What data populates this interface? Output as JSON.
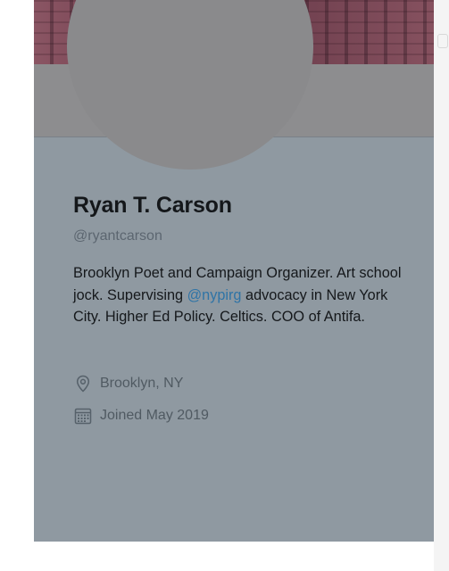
{
  "profile": {
    "name": "Ryan T. Carson",
    "handle": "@ryantcarson",
    "bio": {
      "part1": "Brooklyn Poet and Campaign Organizer. Art school jock. Supervising ",
      "mention": "@nypirg",
      "part2": " advocacy in New York City. Higher Ed Policy. Celtics. COO of Antifa."
    },
    "location": "Brooklyn, NY",
    "joined": "Joined May 2019"
  },
  "icons": {
    "location": "location-pin-icon",
    "joined": "calendar-icon"
  },
  "colors": {
    "card_bg": "#8f99a1",
    "mention": "#2f74a6",
    "name": "#14171a",
    "secondary_text": "#5c6670"
  }
}
